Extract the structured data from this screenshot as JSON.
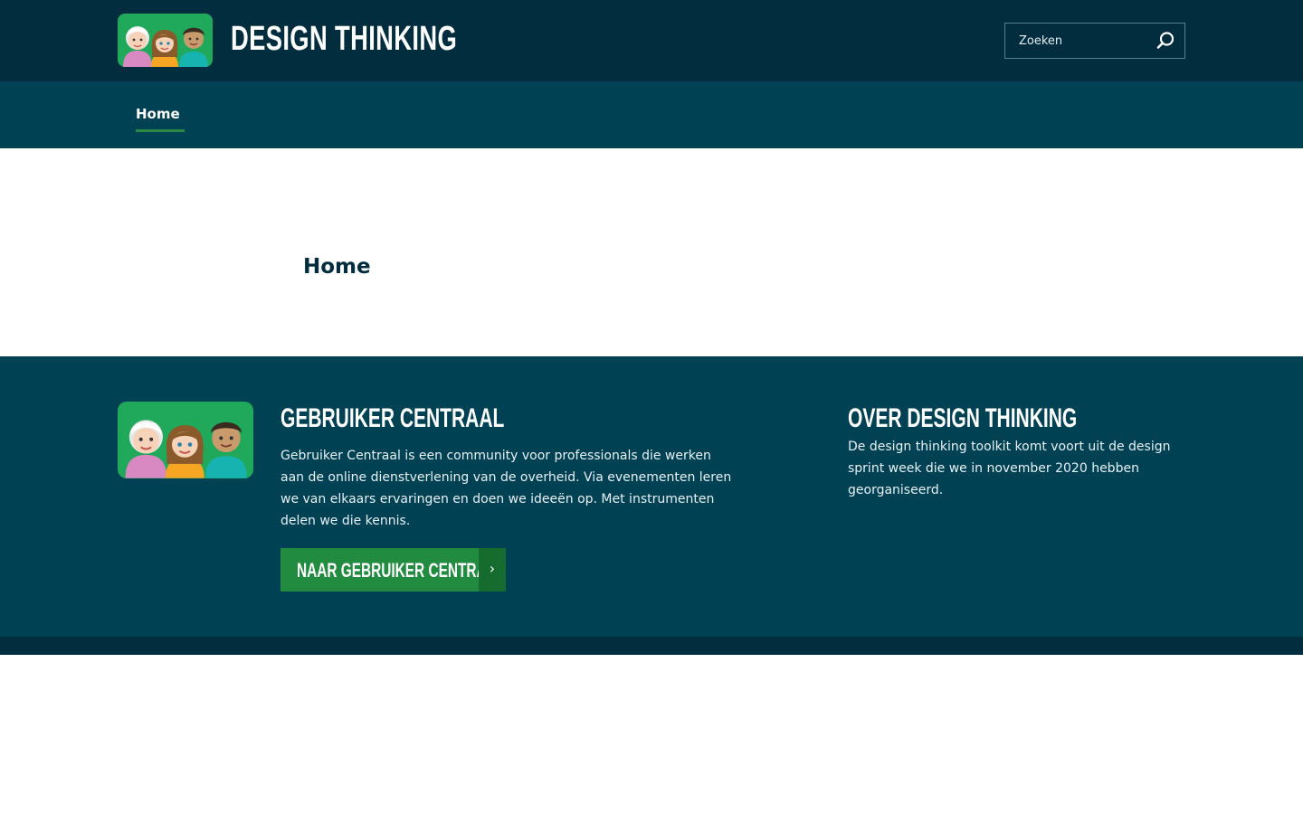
{
  "header": {
    "site_title": "DESIGN THINKING",
    "logo_icon": "people-group-logo-icon",
    "search": {
      "placeholder": "Zoeken",
      "value": "",
      "button_icon": "search-icon"
    }
  },
  "nav": {
    "items": [
      {
        "label": "Home",
        "active": true
      }
    ]
  },
  "main": {
    "page_title": "Home"
  },
  "footer": {
    "gebruiker_centraal": {
      "heading": "GEBRUIKER CENTRAAL",
      "text": "Gebruiker Centraal is een community voor professionals die werken aan de online dienstverlening van de overheid. Via evenementen leren we van elkaars ervaringen en doen we ideeën op. Met instrumenten delen we die kennis.",
      "button_label": "NAAR GEBRUIKER CENTRAAL",
      "button_icon": "chevron-right-icon"
    },
    "over_design_thinking": {
      "heading": "OVER DESIGN THINKING",
      "text": "De design thinking toolkit komt voort uit de design sprint week die we in november 2020 hebben georganiseerd."
    }
  },
  "colors": {
    "header_bg": "#012d3e",
    "nav_bg": "#004254",
    "accent_green": "#218c3f",
    "title_dark": "#012d3e"
  }
}
